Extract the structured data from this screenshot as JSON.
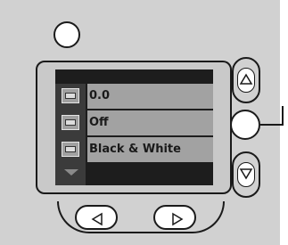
{
  "menu": {
    "items": [
      {
        "label": "0.0",
        "icon": "exposure-compensation-icon",
        "selected": true
      },
      {
        "label": "Off",
        "icon": "flash-icon",
        "selected": false
      },
      {
        "label": "Black & White",
        "icon": "color-mode-icon",
        "selected": false
      }
    ]
  },
  "colors": {
    "body": "#d1d1d1",
    "screen": "#1d1d1d",
    "row_highlight": "#a2a2a2",
    "outline": "#1a1a1a"
  }
}
